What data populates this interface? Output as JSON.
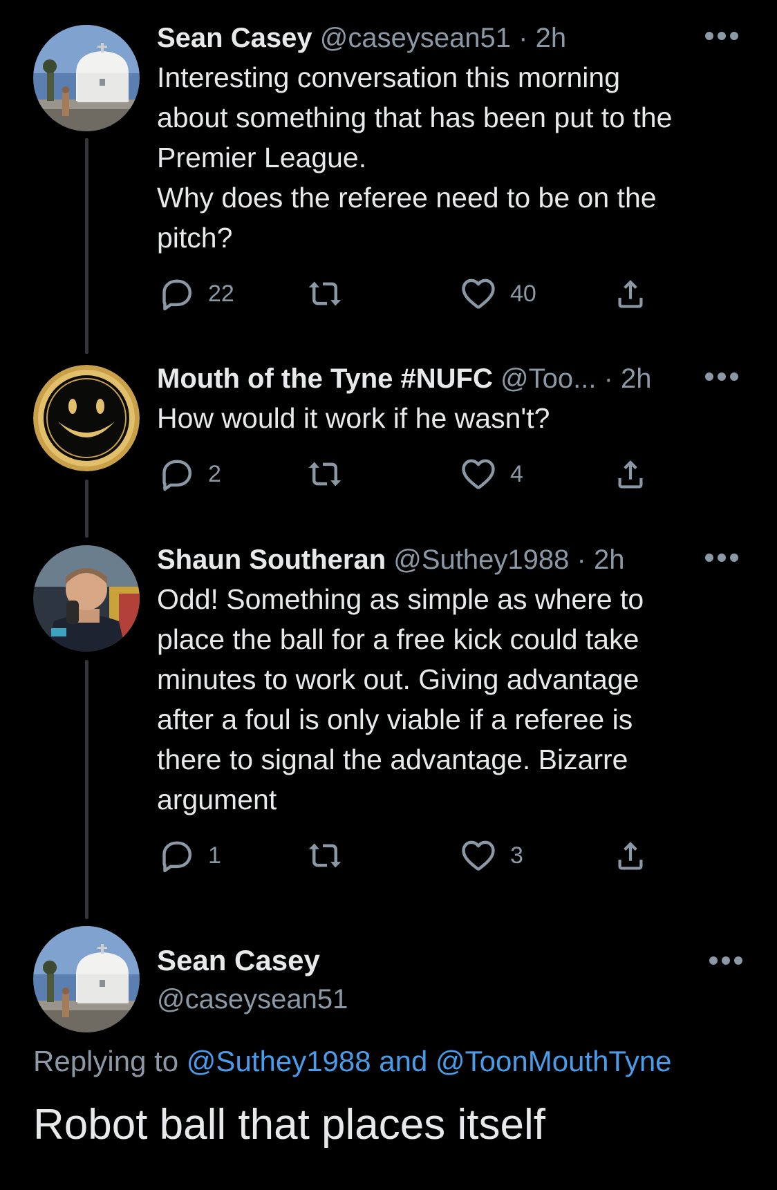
{
  "tweets": [
    {
      "name": "Sean Casey",
      "handle": "@caseysean51",
      "dot": "·",
      "time": "2h",
      "text": "Interesting conversation this morning\nabout something that has been put to the\nPremier League.\nWhy does the referee need to be on the\npitch?",
      "replies": "22",
      "retweets": "",
      "likes": "40",
      "avatar": "dome-building-photo"
    },
    {
      "name": "Mouth of the Tyne #NUFC",
      "handle": "@Too...",
      "dot": "·",
      "time": "2h",
      "text": "How would it work if he wasn't?",
      "replies": "2",
      "retweets": "",
      "likes": "4",
      "avatar": "gold-smiley-face"
    },
    {
      "name": "Shaun Southeran",
      "handle": "@Suthey1988",
      "dot": "·",
      "time": "2h",
      "text": "Odd! Something as simple as where to\nplace the ball for a free kick could take\nminutes to work out. Giving advantage\nafter a foul is only viable if a referee is\nthere to signal the advantage. Bizarre\nargument",
      "replies": "1",
      "retweets": "",
      "likes": "3",
      "avatar": "man-portrait-photo"
    }
  ],
  "main_tweet": {
    "name": "Sean Casey",
    "handle": "@caseysean51",
    "replying_prefix": "Replying to",
    "reply_to_1": "@Suthey1988",
    "reply_and": "and",
    "reply_to_2": "@ToonMouthTyne",
    "text": "Robot ball that places itself"
  },
  "icons": {
    "reply": "reply-icon",
    "retweet": "retweet-icon",
    "like": "heart-icon",
    "share": "share-icon",
    "more": "more-icon"
  },
  "colors": {
    "background": "#000000",
    "text": "#e7e9ea",
    "secondary": "#8b98a5",
    "link": "#4a9ce8",
    "thread_line": "#333639"
  }
}
